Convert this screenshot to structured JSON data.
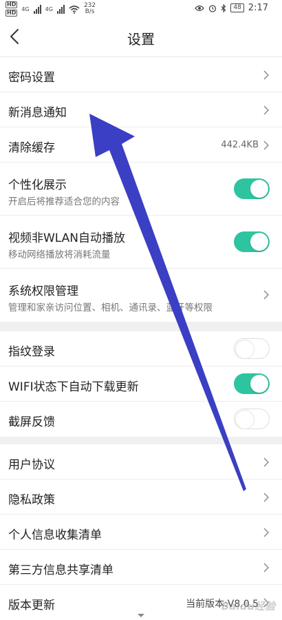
{
  "status_bar": {
    "hd1": "HD",
    "hd2": "HD",
    "net1": "4G",
    "net2": "4G",
    "speed_value": "232",
    "speed_unit": "B/s",
    "battery": "48",
    "time": "2:17"
  },
  "header": {
    "title": "设置"
  },
  "settings": {
    "password": {
      "label": "密码设置"
    },
    "notifications": {
      "label": "新消息通知"
    },
    "clear_cache": {
      "label": "清除缓存",
      "value": "442.4KB"
    },
    "personalized": {
      "label": "个性化展示",
      "sub": "开启后将推荐适合您的内容",
      "enabled": true
    },
    "video_autoplay": {
      "label": "视频非WLAN自动播放",
      "sub": "移动网络播放将消耗流量",
      "enabled": true
    },
    "permissions": {
      "label": "系统权限管理",
      "sub": "管理和家亲访问位置、相机、通讯录、蓝牙等权限"
    },
    "fingerprint": {
      "label": "指纹登录",
      "enabled": false
    },
    "wifi_auto_update": {
      "label": "WIFI状态下自动下载更新",
      "enabled": true
    },
    "screenshot_feedback": {
      "label": "截屏反馈",
      "enabled": false
    },
    "user_agreement": {
      "label": "用户协议"
    },
    "privacy_policy": {
      "label": "隐私政策"
    },
    "personal_info_list": {
      "label": "个人信息收集清单"
    },
    "third_party_list": {
      "label": "第三方信息共享清单"
    },
    "version_update": {
      "label": "版本更新",
      "value": "当前版本:V8.0.5"
    }
  },
  "watermark": "Baidu经验",
  "colors": {
    "toggle_on": "#2ec4a0",
    "annotation_arrow": "#3b3fc4"
  }
}
